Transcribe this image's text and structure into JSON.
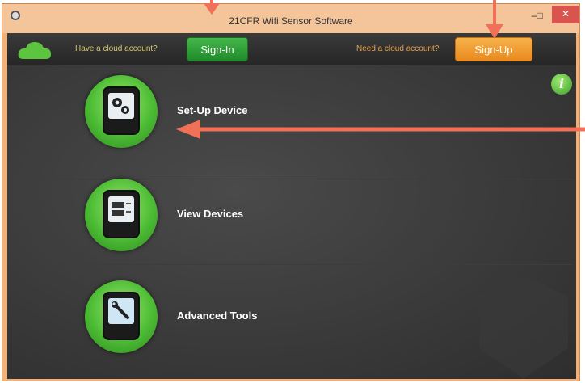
{
  "window": {
    "title": "21CFR Wifi Sensor Software",
    "minimize": "–",
    "maximize": "□",
    "close": "✕"
  },
  "header": {
    "have_account_label": "Have a cloud account?",
    "signin_label": "Sign-In",
    "need_account_label": "Need a cloud account?",
    "signup_label": "Sign-Up"
  },
  "menu": {
    "items": [
      {
        "label": "Set-Up Device",
        "icon": "gears-icon"
      },
      {
        "label": "View Devices",
        "icon": "sensor-display-icon"
      },
      {
        "label": "Advanced Tools",
        "icon": "wrench-icon"
      }
    ],
    "info_icon": "i"
  },
  "colors": {
    "signin": "#2a9d35",
    "signup": "#f0a036",
    "ring": "#4cbc34",
    "arrow": "#f07058"
  }
}
